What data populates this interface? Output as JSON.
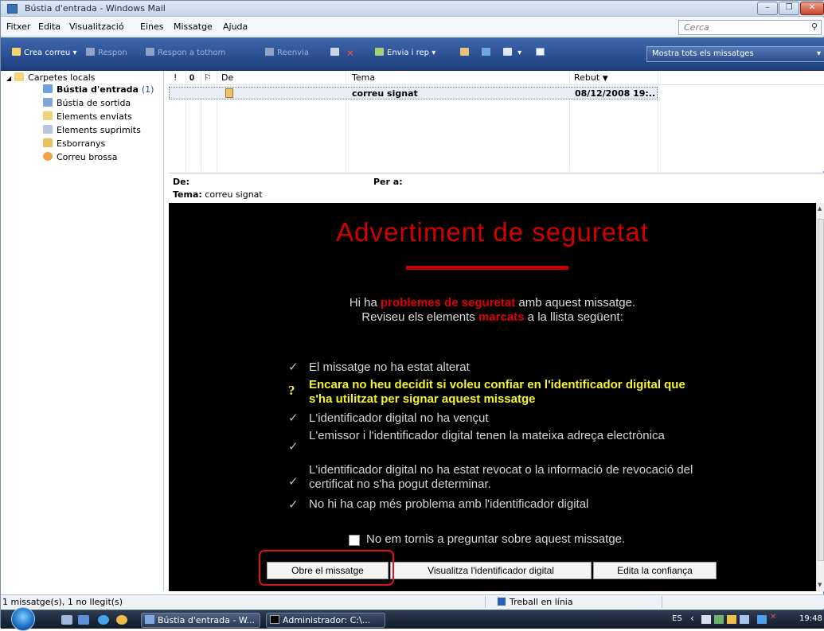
{
  "window": {
    "title": "Bústia d'entrada - Windows Mail",
    "controls": [
      "–",
      "❐",
      "✕"
    ]
  },
  "menubar": {
    "items": [
      "Fitxer",
      "Edita",
      "Visualització",
      "Eines",
      "Missatge",
      "Ajuda"
    ],
    "search_placeholder": "Cerca"
  },
  "toolbar": {
    "create": "Crea correu",
    "reply": "Respon",
    "reply_all": "Respon a tothom",
    "forward": "Reenvia",
    "send_receive": "Envia i rep",
    "view_filter": "Mostra tots els missatges"
  },
  "folders": {
    "root": "Carpetes locals",
    "items": [
      {
        "label": "Bústia d'entrada",
        "count": "(1)"
      },
      {
        "label": "Bústia de sortida"
      },
      {
        "label": "Elements enviats"
      },
      {
        "label": "Elements suprimits"
      },
      {
        "label": "Esborranys"
      },
      {
        "label": "Correu brossa"
      }
    ]
  },
  "message_list": {
    "columns": {
      "priority": "!",
      "attachment": "𝟎",
      "flag": "⚐",
      "from": "De",
      "subject": "Tema",
      "received": "Rebut"
    },
    "rows": [
      {
        "from": "",
        "subject": "correu signat",
        "received": "08/12/2008 19:..."
      }
    ]
  },
  "preview_header": {
    "from_label": "De:",
    "to_label": "Per a:",
    "subject_label": "Tema:",
    "subject_value": "correu signat"
  },
  "security_warning": {
    "title": "Advertiment de seguretat",
    "intro_1a": "Hi ha ",
    "intro_1b": "problemes de seguretat",
    "intro_1c": " amb aquest missatge.",
    "intro_2a": "Reviseu els elements ",
    "intro_2b": "marcats",
    "intro_2c": " a la llista següent:",
    "items": [
      {
        "mark": "✓",
        "text": "El missatge no ha estat alterat"
      },
      {
        "mark": "?",
        "text": "Encara no heu decidit si voleu confiar en l'identificador digital que s'ha utilitzat per signar aquest missatge"
      },
      {
        "mark": "✓",
        "text": "L'identificador digital no ha vençut"
      },
      {
        "mark": "✓",
        "text": "L'emissor i l'identificador digital tenen la mateixa adreça electrònica"
      },
      {
        "mark": "✓",
        "text": "L'identificador digital no ha estat revocat o la informació de revocació del certificat no s'ha pogut determinar."
      },
      {
        "mark": "✓",
        "text": "No hi ha cap més problema amb l'identificador digital"
      }
    ],
    "dont_ask": "No em tornis a preguntar sobre aquest missatge.",
    "buttons": {
      "open": "Obre el missatge",
      "view_id": "Visualitza l'identificador digital",
      "edit_trust": "Edita la confiança"
    }
  },
  "statusbar": {
    "count": "1 missatge(s), 1 no llegit(s)",
    "online": "Treball en línia"
  },
  "taskbar": {
    "tasks": [
      "Bústia d'entrada - W...",
      "Administrador: C:\\..."
    ],
    "lang": "ES",
    "clock": "19:48"
  },
  "colors": {
    "warning_red": "#d20000",
    "warning_yellow": "#f4f42e",
    "highlight_outline": "#e01020"
  }
}
